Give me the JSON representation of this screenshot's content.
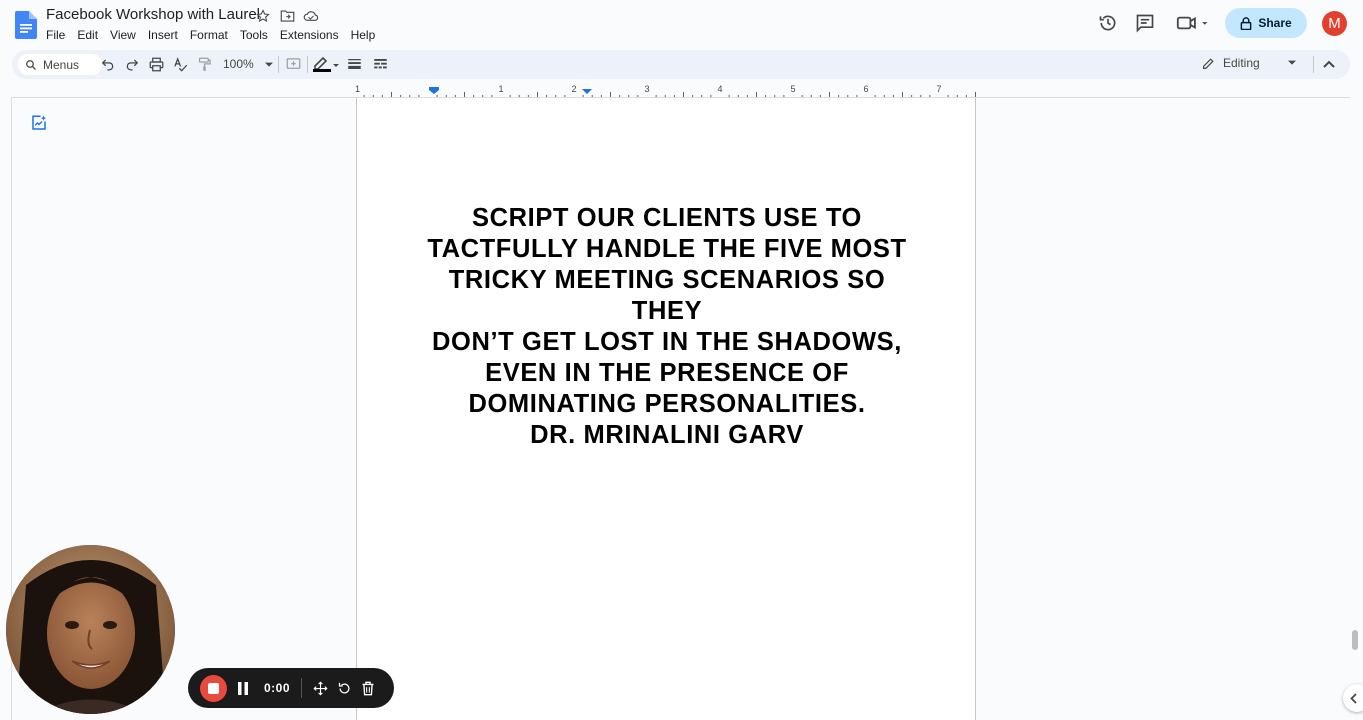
{
  "app": {
    "title": "Facebook Workshop with Laurel",
    "menu": [
      "File",
      "Edit",
      "View",
      "Insert",
      "Format",
      "Tools",
      "Extensions",
      "Help"
    ],
    "share_label": "Share",
    "avatar_letter": "M"
  },
  "toolbar": {
    "search_placeholder": "Menus",
    "zoom": "100%",
    "mode": "Editing"
  },
  "ruler": {
    "labels": [
      "1",
      "1",
      "2",
      "3",
      "4",
      "5",
      "6",
      "7"
    ]
  },
  "document": {
    "body_lines": [
      "SCRIPT OUR CLIENTS USE TO",
      "TACTFULLY HANDLE THE FIVE MOST",
      "TRICKY MEETING SCENARIOS SO THEY",
      "DON’T GET LOST IN THE SHADOWS,",
      "EVEN IN THE PRESENCE OF",
      "DOMINATING PERSONALITIES."
    ],
    "author": "DR. MRINALINI GARV"
  },
  "recorder": {
    "time": "0:00"
  },
  "colors": {
    "share_bg": "#c2e7ff",
    "avatar_bg": "#e2402e",
    "record_red": "#e84a3f",
    "docs_blue": "#4285f4"
  }
}
